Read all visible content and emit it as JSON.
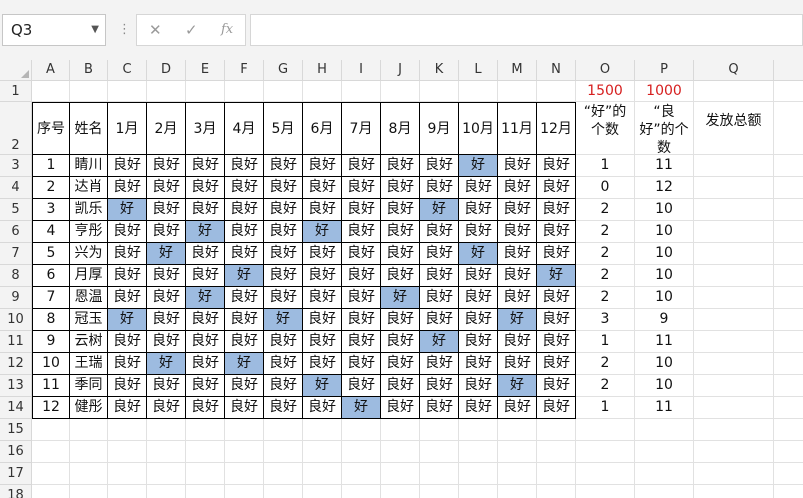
{
  "formula_bar": {
    "name_box": "Q3",
    "cancel_icon": "✕",
    "enter_icon": "✓",
    "fx_label": "fx",
    "formula": ""
  },
  "sheet": {
    "columns": [
      "A",
      "B",
      "C",
      "D",
      "E",
      "F",
      "G",
      "H",
      "I",
      "J",
      "K",
      "L",
      "M",
      "N",
      "O",
      "P",
      "Q",
      "R"
    ],
    "rows": [
      "1",
      "2",
      "3",
      "4",
      "5",
      "6",
      "7",
      "8",
      "9",
      "10",
      "11",
      "12",
      "13",
      "14",
      "15",
      "16",
      "17",
      "18"
    ],
    "selected_cell": "Q3",
    "row1": {
      "O": "1500",
      "P": "1000"
    },
    "headers": [
      "序号",
      "姓名",
      "1月",
      "2月",
      "3月",
      "4月",
      "5月",
      "6月",
      "7月",
      "8月",
      "9月",
      "10月",
      "11月",
      "12月"
    ],
    "header_O": "“好”的个数",
    "header_P": "“良好”的个数",
    "header_Q": "发放总额",
    "records": [
      {
        "no": "1",
        "name": "睛川",
        "months": [
          "良好",
          "良好",
          "良好",
          "良好",
          "良好",
          "良好",
          "良好",
          "良好",
          "良好",
          "好",
          "良好",
          "良好"
        ],
        "good": "1",
        "fine": "11"
      },
      {
        "no": "2",
        "name": "达肖",
        "months": [
          "良好",
          "良好",
          "良好",
          "良好",
          "良好",
          "良好",
          "良好",
          "良好",
          "良好",
          "良好",
          "良好",
          "良好"
        ],
        "good": "0",
        "fine": "12"
      },
      {
        "no": "3",
        "name": "凯乐",
        "months": [
          "好",
          "良好",
          "良好",
          "良好",
          "良好",
          "良好",
          "良好",
          "良好",
          "好",
          "良好",
          "良好",
          "良好"
        ],
        "good": "2",
        "fine": "10"
      },
      {
        "no": "4",
        "name": "亨彤",
        "months": [
          "良好",
          "良好",
          "好",
          "良好",
          "良好",
          "好",
          "良好",
          "良好",
          "良好",
          "良好",
          "良好",
          "良好"
        ],
        "good": "2",
        "fine": "10"
      },
      {
        "no": "5",
        "name": "兴为",
        "months": [
          "良好",
          "好",
          "良好",
          "良好",
          "良好",
          "良好",
          "良好",
          "良好",
          "良好",
          "好",
          "良好",
          "良好"
        ],
        "good": "2",
        "fine": "10"
      },
      {
        "no": "6",
        "name": "月厚",
        "months": [
          "良好",
          "良好",
          "良好",
          "好",
          "良好",
          "良好",
          "良好",
          "良好",
          "良好",
          "良好",
          "良好",
          "好"
        ],
        "good": "2",
        "fine": "10"
      },
      {
        "no": "7",
        "name": "恩温",
        "months": [
          "良好",
          "良好",
          "好",
          "良好",
          "良好",
          "良好",
          "良好",
          "好",
          "良好",
          "良好",
          "良好",
          "良好"
        ],
        "good": "2",
        "fine": "10"
      },
      {
        "no": "8",
        "name": "冠玉",
        "months": [
          "好",
          "良好",
          "良好",
          "良好",
          "好",
          "良好",
          "良好",
          "良好",
          "良好",
          "良好",
          "好",
          "良好"
        ],
        "good": "3",
        "fine": "9"
      },
      {
        "no": "9",
        "name": "云树",
        "months": [
          "良好",
          "良好",
          "良好",
          "良好",
          "良好",
          "良好",
          "良好",
          "良好",
          "好",
          "良好",
          "良好",
          "良好"
        ],
        "good": "1",
        "fine": "11"
      },
      {
        "no": "10",
        "name": "王瑞",
        "months": [
          "良好",
          "好",
          "良好",
          "好",
          "良好",
          "良好",
          "良好",
          "良好",
          "良好",
          "良好",
          "良好",
          "良好"
        ],
        "good": "2",
        "fine": "10"
      },
      {
        "no": "11",
        "name": "季同",
        "months": [
          "良好",
          "良好",
          "良好",
          "良好",
          "良好",
          "好",
          "良好",
          "良好",
          "良好",
          "良好",
          "好",
          "良好"
        ],
        "good": "2",
        "fine": "10"
      },
      {
        "no": "12",
        "name": "健彤",
        "months": [
          "良好",
          "良好",
          "良好",
          "良好",
          "良好",
          "良好",
          "好",
          "良好",
          "良好",
          "良好",
          "良好",
          "良好"
        ],
        "good": "1",
        "fine": "11"
      }
    ]
  },
  "colors": {
    "highlight": "#9dbbe0",
    "red_text": "#d61f1f",
    "header_bg": "#f3f3f3"
  }
}
